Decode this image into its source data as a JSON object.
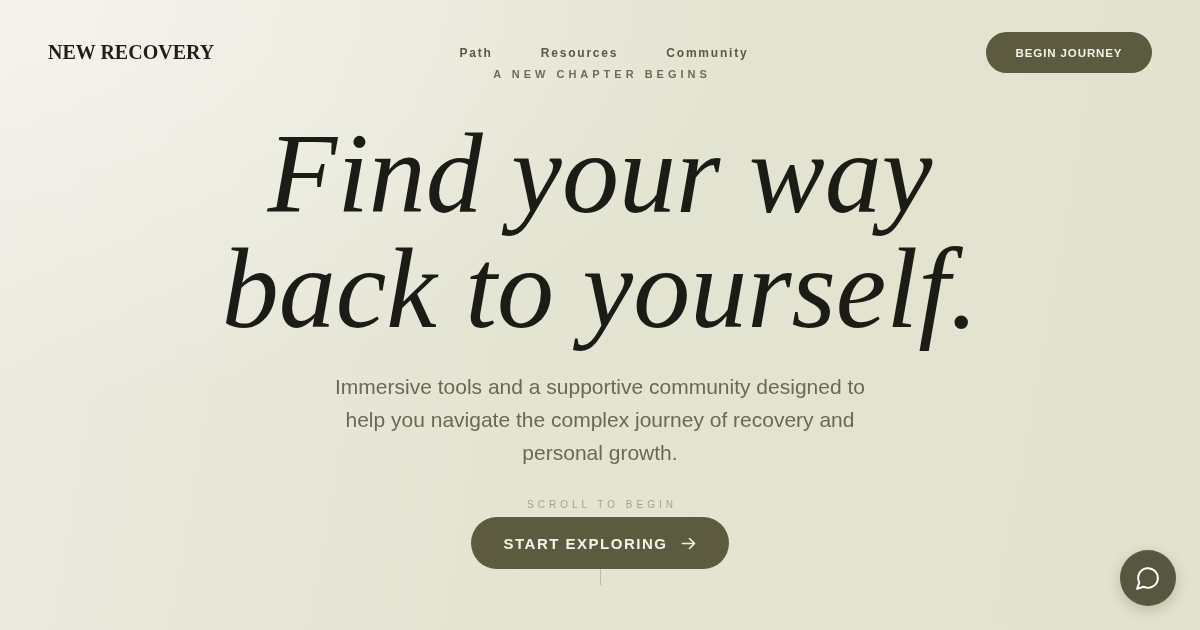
{
  "brand": {
    "name": "NEW RECOVERY"
  },
  "nav": {
    "links": [
      "Path",
      "Resources",
      "Community"
    ],
    "cta": "BEGIN JOURNEY"
  },
  "hero": {
    "eyebrow": "A NEW CHAPTER BEGINS",
    "headline": "Find your way back to yourself.",
    "subtitle": "Immersive tools and a supportive community designed to help you navigate the complex journey of recovery and personal growth.",
    "scroll_hint": "SCROLL TO BEGIN",
    "button": {
      "label": "START EXPLORING"
    }
  }
}
